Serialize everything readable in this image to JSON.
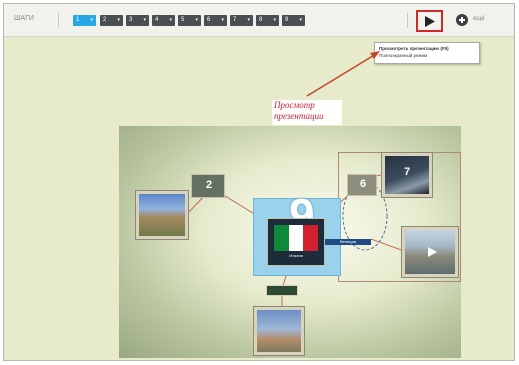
{
  "toolbar": {
    "label": "ШАГИ",
    "steps": [
      {
        "label": "1"
      },
      {
        "label": "2"
      },
      {
        "label": "3"
      },
      {
        "label": "4"
      },
      {
        "label": "5"
      },
      {
        "label": "6"
      },
      {
        "label": "7"
      },
      {
        "label": "8"
      },
      {
        "label": "9"
      }
    ],
    "active_step": 1,
    "dropdown_glyph": "▾",
    "more_label": "ещё"
  },
  "tooltip": {
    "line1": "Просмотреть презентацию (F5)",
    "line2": "Полноэкранный режим"
  },
  "callout": {
    "text": "Просмотр презентации"
  },
  "canvas": {
    "big_number": "9",
    "step_tags": [
      "2",
      "6",
      "7"
    ],
    "caption_text": "Италия",
    "blue_label": "Венеция"
  },
  "colors": {
    "accent_active": "#2aa6e3",
    "highlight_border": "#d22a2a",
    "callout_text": "#c9253c",
    "step_bg": "#4a4f52"
  },
  "icons": {
    "play": "play-icon",
    "add": "plus-circle-icon"
  }
}
